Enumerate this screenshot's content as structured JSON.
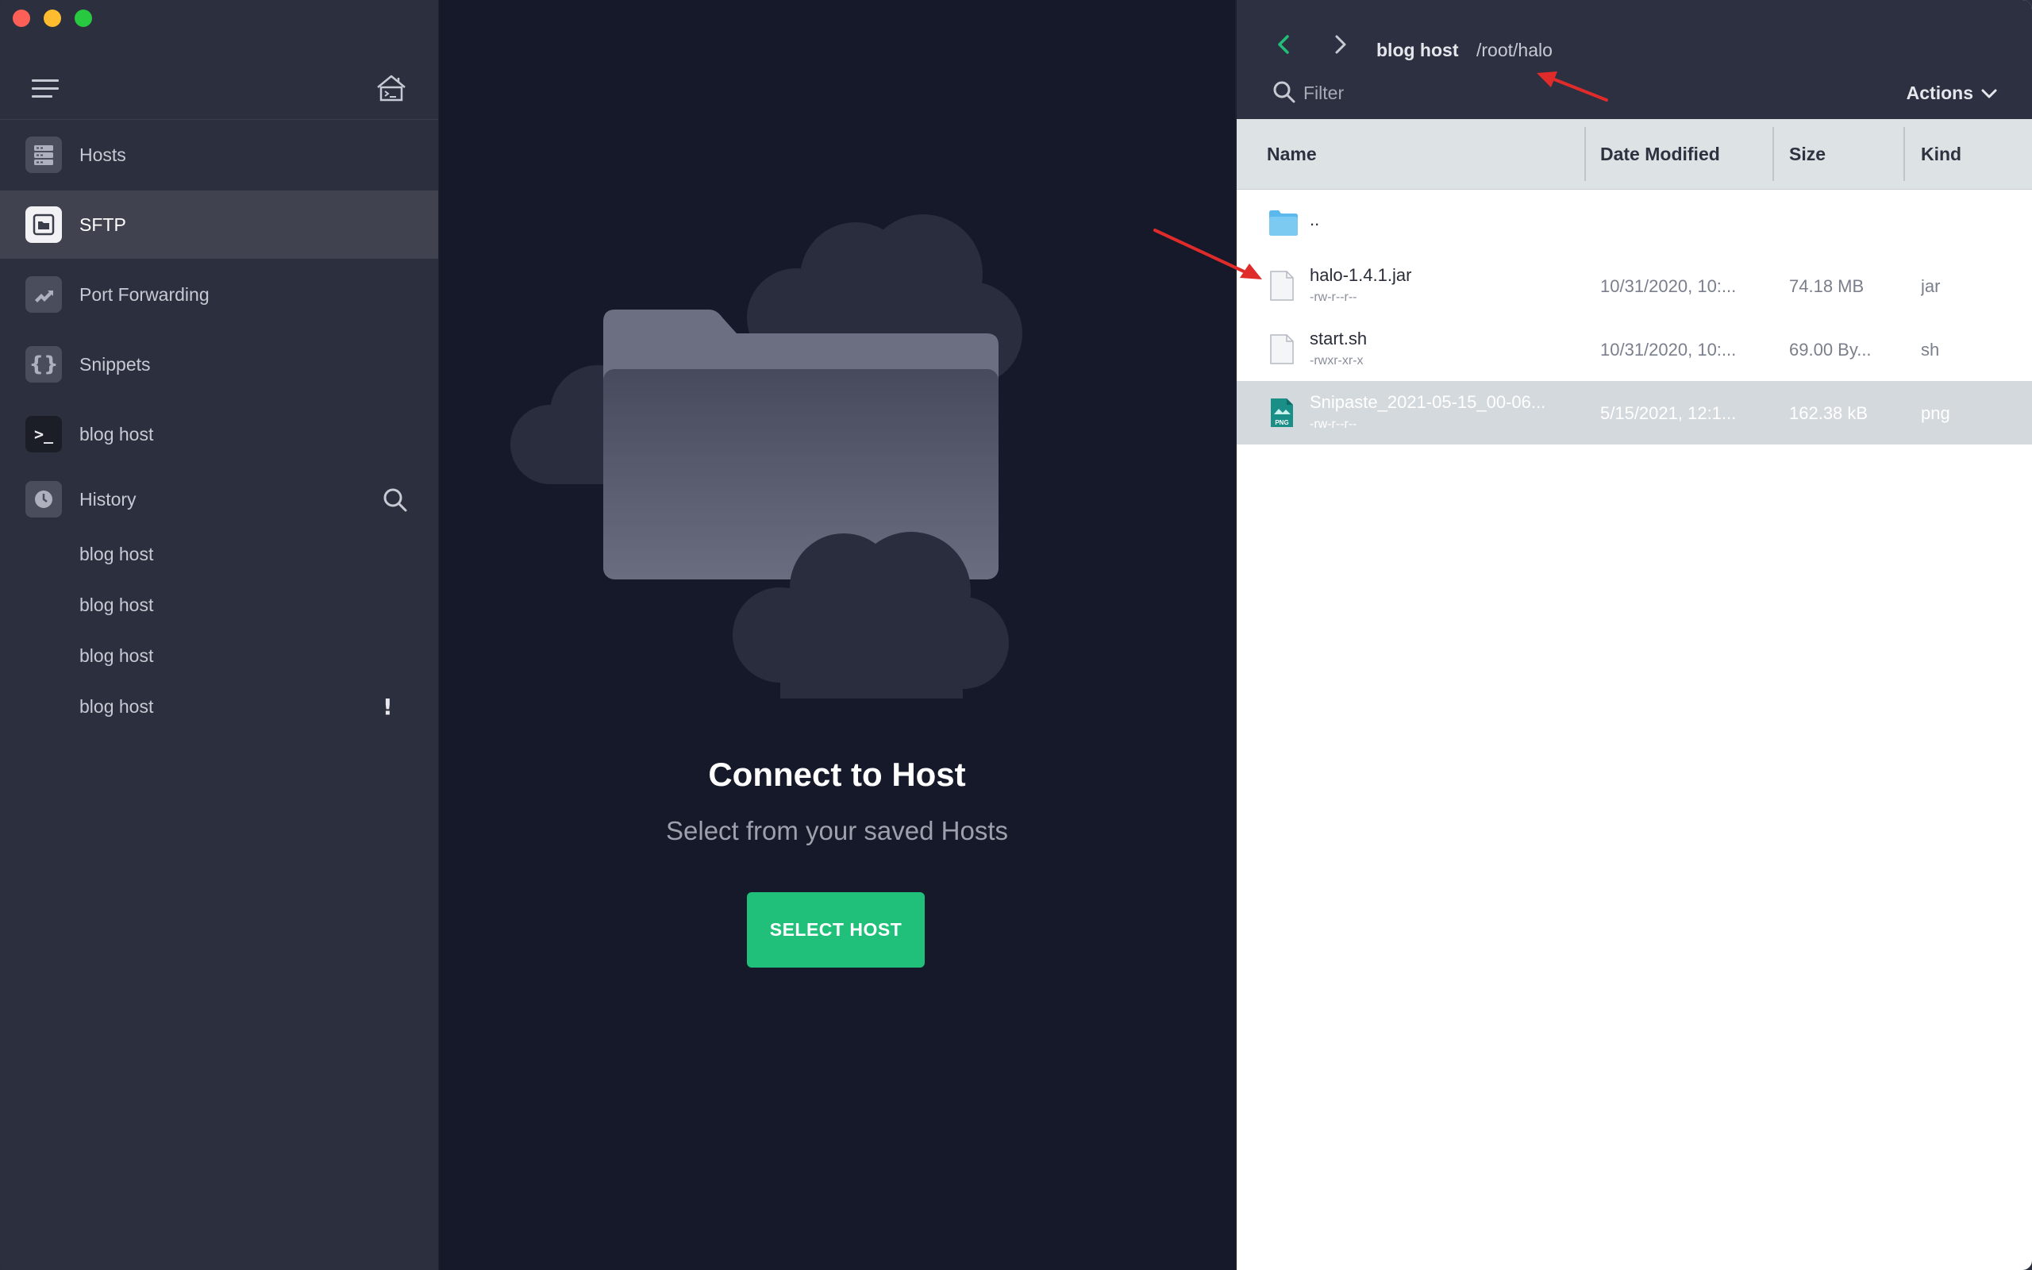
{
  "sidebar": {
    "nav": [
      {
        "label": "Hosts",
        "icon": "server-icon"
      },
      {
        "label": "SFTP",
        "icon": "folder-icon"
      },
      {
        "label": "Port Forwarding",
        "icon": "forward-arrow-icon"
      },
      {
        "label": "Snippets",
        "icon": "braces-icon",
        "glyph": "{}"
      },
      {
        "label": "blog host",
        "icon": "terminal-icon",
        "glyph": ">_"
      }
    ],
    "history_label": "History",
    "history_items": [
      "blog host",
      "blog host",
      "blog host",
      "blog host"
    ],
    "warning_glyph": "!"
  },
  "middle": {
    "title": "Connect to Host",
    "subtitle": "Select from your saved Hosts",
    "button_label": "SELECT HOST"
  },
  "sftp": {
    "host": "blog host",
    "path": "/root/halo",
    "filter_placeholder": "Filter",
    "actions_label": "Actions",
    "columns": {
      "name": "Name",
      "date": "Date Modified",
      "size": "Size",
      "kind": "Kind"
    },
    "parent_dir": "..",
    "files": [
      {
        "name": "halo-1.4.1.jar",
        "perm": "-rw-r--r--",
        "date": "10/31/2020, 10:...",
        "size": "74.18 MB",
        "kind": "jar"
      },
      {
        "name": "start.sh",
        "perm": "-rwxr-xr-x",
        "date": "10/31/2020, 10:...",
        "size": "69.00 By...",
        "kind": "sh"
      },
      {
        "name": "Snipaste_2021-05-15_00-06...",
        "perm": "-rw-r--r--",
        "date": "5/15/2021, 12:1...",
        "size": "162.38 kB",
        "kind": "png",
        "badge": "PNG"
      }
    ]
  },
  "colors": {
    "accent_green": "#21c07a",
    "sidebar_bg": "#2c2f3e",
    "middle_bg": "#161929",
    "annotation_red": "#e02b2b",
    "folder_blue": "#5bb8ec"
  }
}
